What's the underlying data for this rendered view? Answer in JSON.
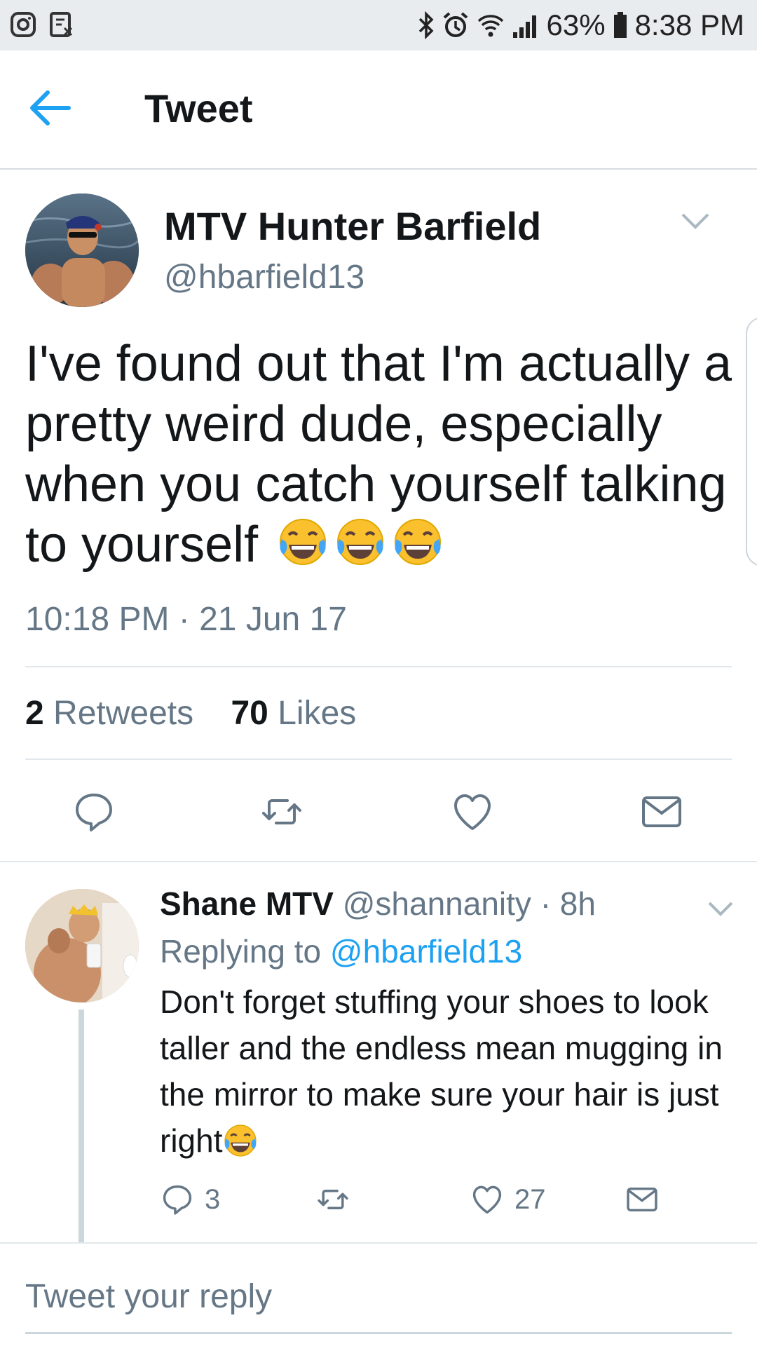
{
  "status_bar": {
    "battery": "63%",
    "time": "8:38 PM"
  },
  "header": {
    "title": "Tweet"
  },
  "tweet": {
    "author_name": "MTV Hunter Barfield",
    "author_handle": "@hbarfield13",
    "text": "I've found out that I'm actually a pretty weird dude, especially when you catch yourself talking to yourself",
    "emoji": "face-with-tears-of-joy",
    "timestamp": "10:18 PM · 21 Jun 17",
    "retweets_count": "2",
    "retweets_label": "Retweets",
    "likes_count": "70",
    "likes_label": "Likes"
  },
  "reply": {
    "author_name": "Shane MTV",
    "author_handle": "@shannanity",
    "time": "· 8h",
    "replying_prefix": "Replying to",
    "replying_handle": "@hbarfield13",
    "text": "Don't forget stuffing your shoes to look taller and the endless mean mugging in the mirror  to make sure your hair is just right",
    "reply_count": "3",
    "like_count": "27"
  },
  "composer": {
    "placeholder": "Tweet your reply"
  },
  "colors": {
    "accent": "#1da1f2",
    "secondary_text": "#657786",
    "divider": "#e1e8ed"
  }
}
